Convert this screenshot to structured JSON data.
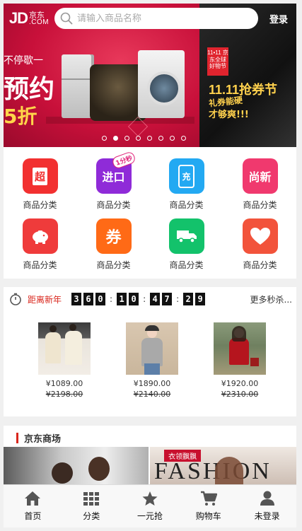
{
  "header": {
    "logo_main": "JD",
    "logo_cn": "京东",
    "logo_com": ".COM",
    "search_placeholder": "请输入商品名称",
    "login": "登录"
  },
  "banner": {
    "left": {
      "line1": "不停歇一",
      "line2": "预约",
      "line3": "5折"
    },
    "right": {
      "badge": "11•11 京东全球好物节",
      "title": "11.11抢券节",
      "sub1": "礼券能硬",
      "sub2": "才够爽!!!"
    },
    "dot_count": 8,
    "active_dot": 1
  },
  "categories": [
    {
      "label": "商品分类",
      "icon": "cart-icon",
      "glyph": "超",
      "color": "#f23030"
    },
    {
      "label": "商品分类",
      "icon": "recharge-icon",
      "glyph": "进口",
      "badge": "1分秒",
      "color": "#8f2bd8"
    },
    {
      "label": "商品分类",
      "icon": "phone-recharge-icon",
      "glyph": "充",
      "color": "#23a9f2"
    },
    {
      "label": "商品分类",
      "icon": "hanger-icon",
      "glyph": "尚新",
      "color": "#f0396e"
    },
    {
      "label": "商品分类",
      "icon": "piggy-bank-icon",
      "glyph": "",
      "color": "#ef3b3b"
    },
    {
      "label": "商品分类",
      "icon": "coupon-icon",
      "glyph": "券",
      "color": "#ff6a16"
    },
    {
      "label": "商品分类",
      "icon": "truck-icon",
      "glyph": "",
      "color": "#13c26b"
    },
    {
      "label": "商品分类",
      "icon": "heart-icon",
      "glyph": "",
      "color": "#f2533b"
    }
  ],
  "seckill": {
    "title": "距离新年",
    "timer": [
      "3",
      "6",
      "0",
      "1",
      "0",
      "4",
      "7",
      "2",
      "9"
    ],
    "more": "更多秒杀...",
    "products": [
      {
        "price": "¥1089.00",
        "original": "¥2198.00"
      },
      {
        "price": "¥1890.00",
        "original": "¥2140.00"
      },
      {
        "price": "¥1920.00",
        "original": "¥2310.00"
      }
    ]
  },
  "mall": {
    "title": "京东商场",
    "tag": "衣领飘飘",
    "fashion": "FASHION"
  },
  "tabbar": [
    {
      "label": "首页",
      "icon": "home-icon"
    },
    {
      "label": "分类",
      "icon": "grid-icon"
    },
    {
      "label": "一元抢",
      "icon": "star-icon"
    },
    {
      "label": "购物车",
      "icon": "shopping-cart-icon"
    },
    {
      "label": "未登录",
      "icon": "user-icon"
    }
  ],
  "colors": {
    "accent": "#d9261c",
    "banner_red": "#c8103a",
    "header_text": "#ffffff"
  }
}
